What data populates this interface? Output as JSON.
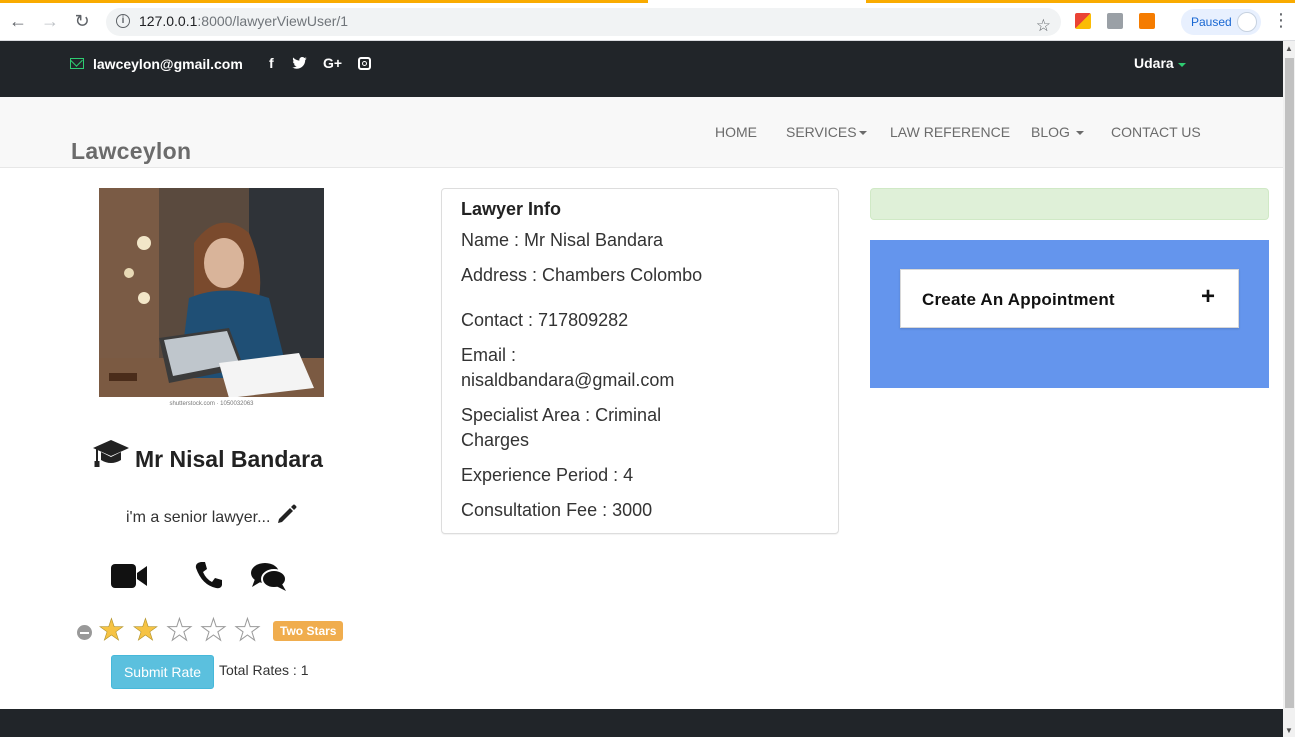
{
  "browser": {
    "url_host": "127.0.0.1",
    "url_rest": ":8000/lawyerViewUser/1",
    "profile_status": "Paused"
  },
  "topbar": {
    "email": "lawceylon@gmail.com",
    "social_icons": [
      "facebook-icon",
      "twitter-icon",
      "google-plus-icon",
      "instagram-icon"
    ],
    "facebook_glyph": "f",
    "google_glyph": "G+",
    "user": "Udara",
    "accent_color": "#2ecc71"
  },
  "navbar": {
    "brand": "Lawceylon",
    "menu": {
      "home": "HOME",
      "services": "SERVICES",
      "law_reference": "LAW REFERENCE",
      "blog": "BLOG",
      "contact_us": "CONTACT US"
    }
  },
  "profile": {
    "photo_caption": "shutterstock.com · 1050032063",
    "name": "Mr Nisal Bandara",
    "bio": "i'm a senior lawyer...",
    "rating": {
      "value": 2,
      "max": 5,
      "label": "Two Stars",
      "submit_label": "Submit Rate",
      "total_rates": "Total Rates : 1"
    }
  },
  "lawyer_info": {
    "title": "Lawyer Info",
    "name": "Name : Mr Nisal Bandara",
    "address": "Address : Chambers Colombo",
    "contact": "Contact : 717809282",
    "email_label": "Email :",
    "email_value": "nisaldbandara@gmail.com",
    "specialist_1": "Specialist Area : Criminal",
    "specialist_2": "Charges",
    "experience": "Experience Period : 4",
    "fee": "Consultation Fee : 3000"
  },
  "appointment": {
    "label": "Create An Appointment",
    "plus": "+",
    "panel_color": "#6495ed"
  }
}
